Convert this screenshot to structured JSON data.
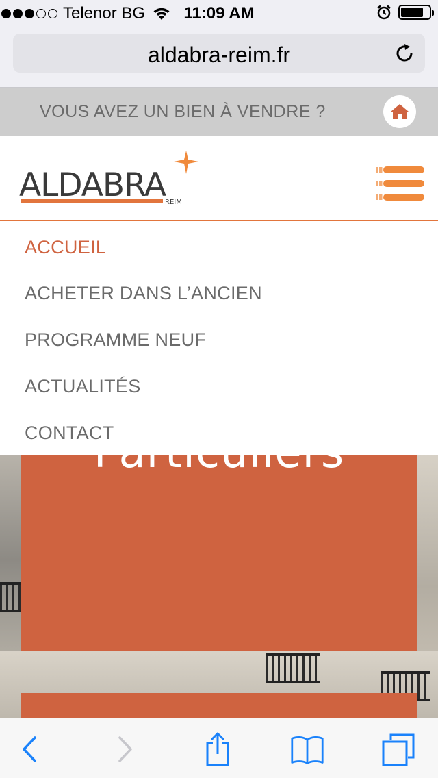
{
  "status_bar": {
    "carrier": "Telenor BG",
    "time": "11:09 AM",
    "signal_bars_filled": 3,
    "signal_bars_total": 5,
    "battery_level_fraction": 0.8
  },
  "browser": {
    "url": "aldabra-reim.fr"
  },
  "banner": {
    "text": "VOUS AVEZ UN BIEN À VENDRE ?",
    "home_icon": "home-icon"
  },
  "header": {
    "logo_text": "ALDABRA",
    "logo_subtext": "REIM",
    "menu_icon": "hamburger-icon"
  },
  "menu": {
    "items": [
      {
        "label": "ACCUEIL",
        "active": true
      },
      {
        "label": "ACHETER DANS L’ANCIEN",
        "active": false
      },
      {
        "label": "PROGRAMME NEUF",
        "active": false
      },
      {
        "label": "ACTUALITÉS",
        "active": false
      },
      {
        "label": "CONTACT",
        "active": false
      }
    ]
  },
  "hero": {
    "card_title": "Particuliers"
  },
  "colors": {
    "accent": "#cf6340",
    "accent_light": "#f08a3c",
    "ios_blue": "#1a82fb",
    "menu_text": "#6b6b6b",
    "banner_bg": "#cdcdcd"
  },
  "toolbar": {
    "icons": [
      "back-icon",
      "forward-icon",
      "share-icon",
      "bookmarks-icon",
      "tabs-icon"
    ]
  }
}
